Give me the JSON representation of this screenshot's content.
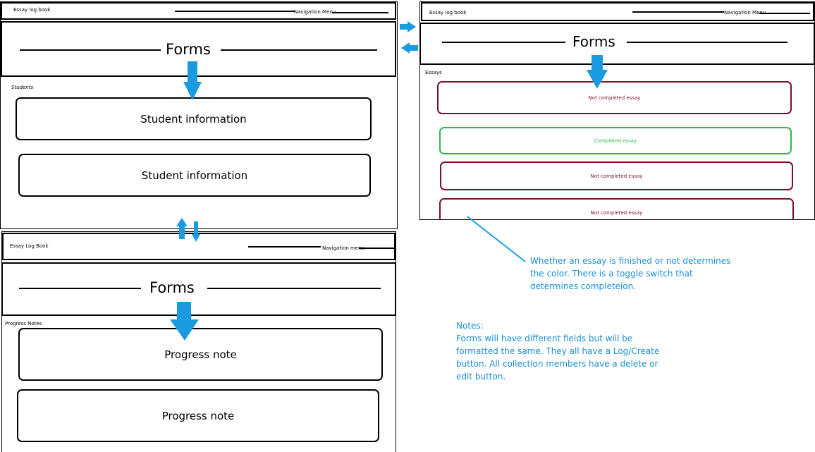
{
  "wireframe_top_left": {
    "app_title": "Essay log book",
    "nav_label": "Navigation Menu",
    "header_title": "Forms",
    "section_label": "Students",
    "cards": [
      "Student information",
      "Student information"
    ]
  },
  "wireframe_top_right": {
    "app_title": "Essay log book",
    "nav_label": "Navigation Menu",
    "header_title": "Forms",
    "section_label": "Essays",
    "cards": [
      {
        "label": "Not completed essay",
        "status": "not-completed"
      },
      {
        "label": "Completed essay",
        "status": "completed"
      },
      {
        "label": "Not completed essay",
        "status": "not-completed"
      },
      {
        "label": "Not completed essay",
        "status": "not-completed"
      }
    ]
  },
  "wireframe_bottom_left": {
    "app_title": "Essay Log Book",
    "nav_label": "Navigation menu",
    "header_title": "Forms",
    "section_label": "Progress Notes",
    "cards": [
      "Progress note",
      "Progress note"
    ]
  },
  "annotation_color": "Whether an essay is finished or not determines the color. There is a toggle switch that determines completeion.",
  "notes": {
    "heading": "Notes:",
    "body": "Forms will have different fields but will be formatted the same. They all have a Log/Create button. All collection members have a delete or edit button."
  },
  "colors": {
    "arrow": "#1a9be0",
    "not_completed": "#7a0f25",
    "completed": "#2fb84a",
    "annotation_text": "#1a8fd6"
  }
}
